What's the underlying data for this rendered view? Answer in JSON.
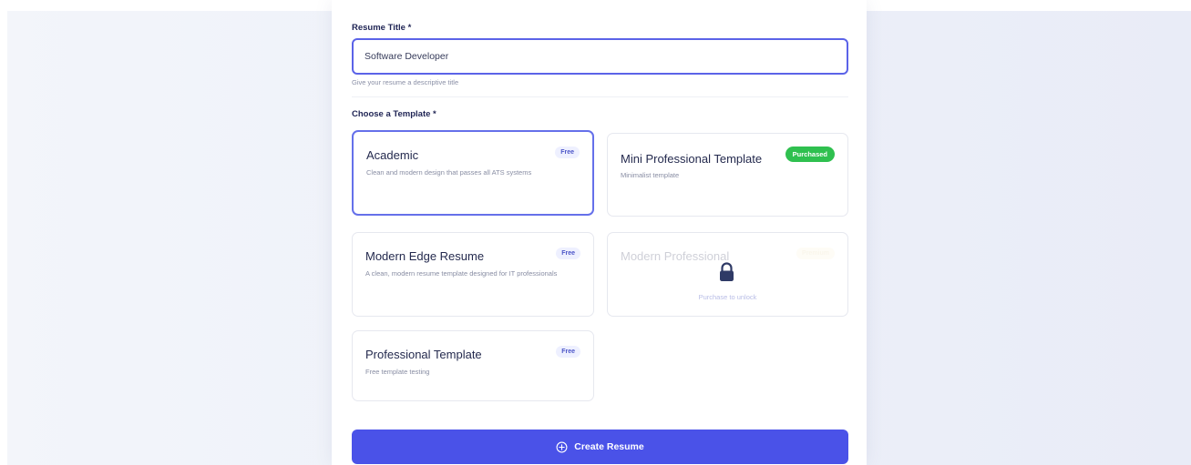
{
  "form": {
    "title_label": "Resume Title *",
    "title_value": "Software Developer",
    "title_hint": "Give your resume a descriptive title",
    "template_label": "Choose a Template *"
  },
  "templates": [
    {
      "name": "Academic",
      "description": "Clean and modern design that passes all ATS systems",
      "badge": "Free",
      "selected": true
    },
    {
      "name": "Mini Professional Template",
      "description": "Minimalist template",
      "badge": "Purchased"
    },
    {
      "name": "Modern Edge Resume",
      "description": "A clean, modern resume template designed for IT professionals",
      "badge": "Free"
    },
    {
      "name": "Modern Professional",
      "description": "",
      "badge": "Premium",
      "locked": true,
      "locked_text": "Purchase to unlock"
    },
    {
      "name": "Professional Template",
      "description": "Free template testing",
      "badge": "Free"
    }
  ],
  "actions": {
    "create_label": "Create Resume"
  },
  "colors": {
    "accent": "#4a52e8",
    "selected_border": "#6570ea",
    "purchased": "#2fc04f",
    "title": "#1f2454"
  },
  "icons": {
    "create": "plus-circle-icon",
    "locked": "lock-icon"
  }
}
